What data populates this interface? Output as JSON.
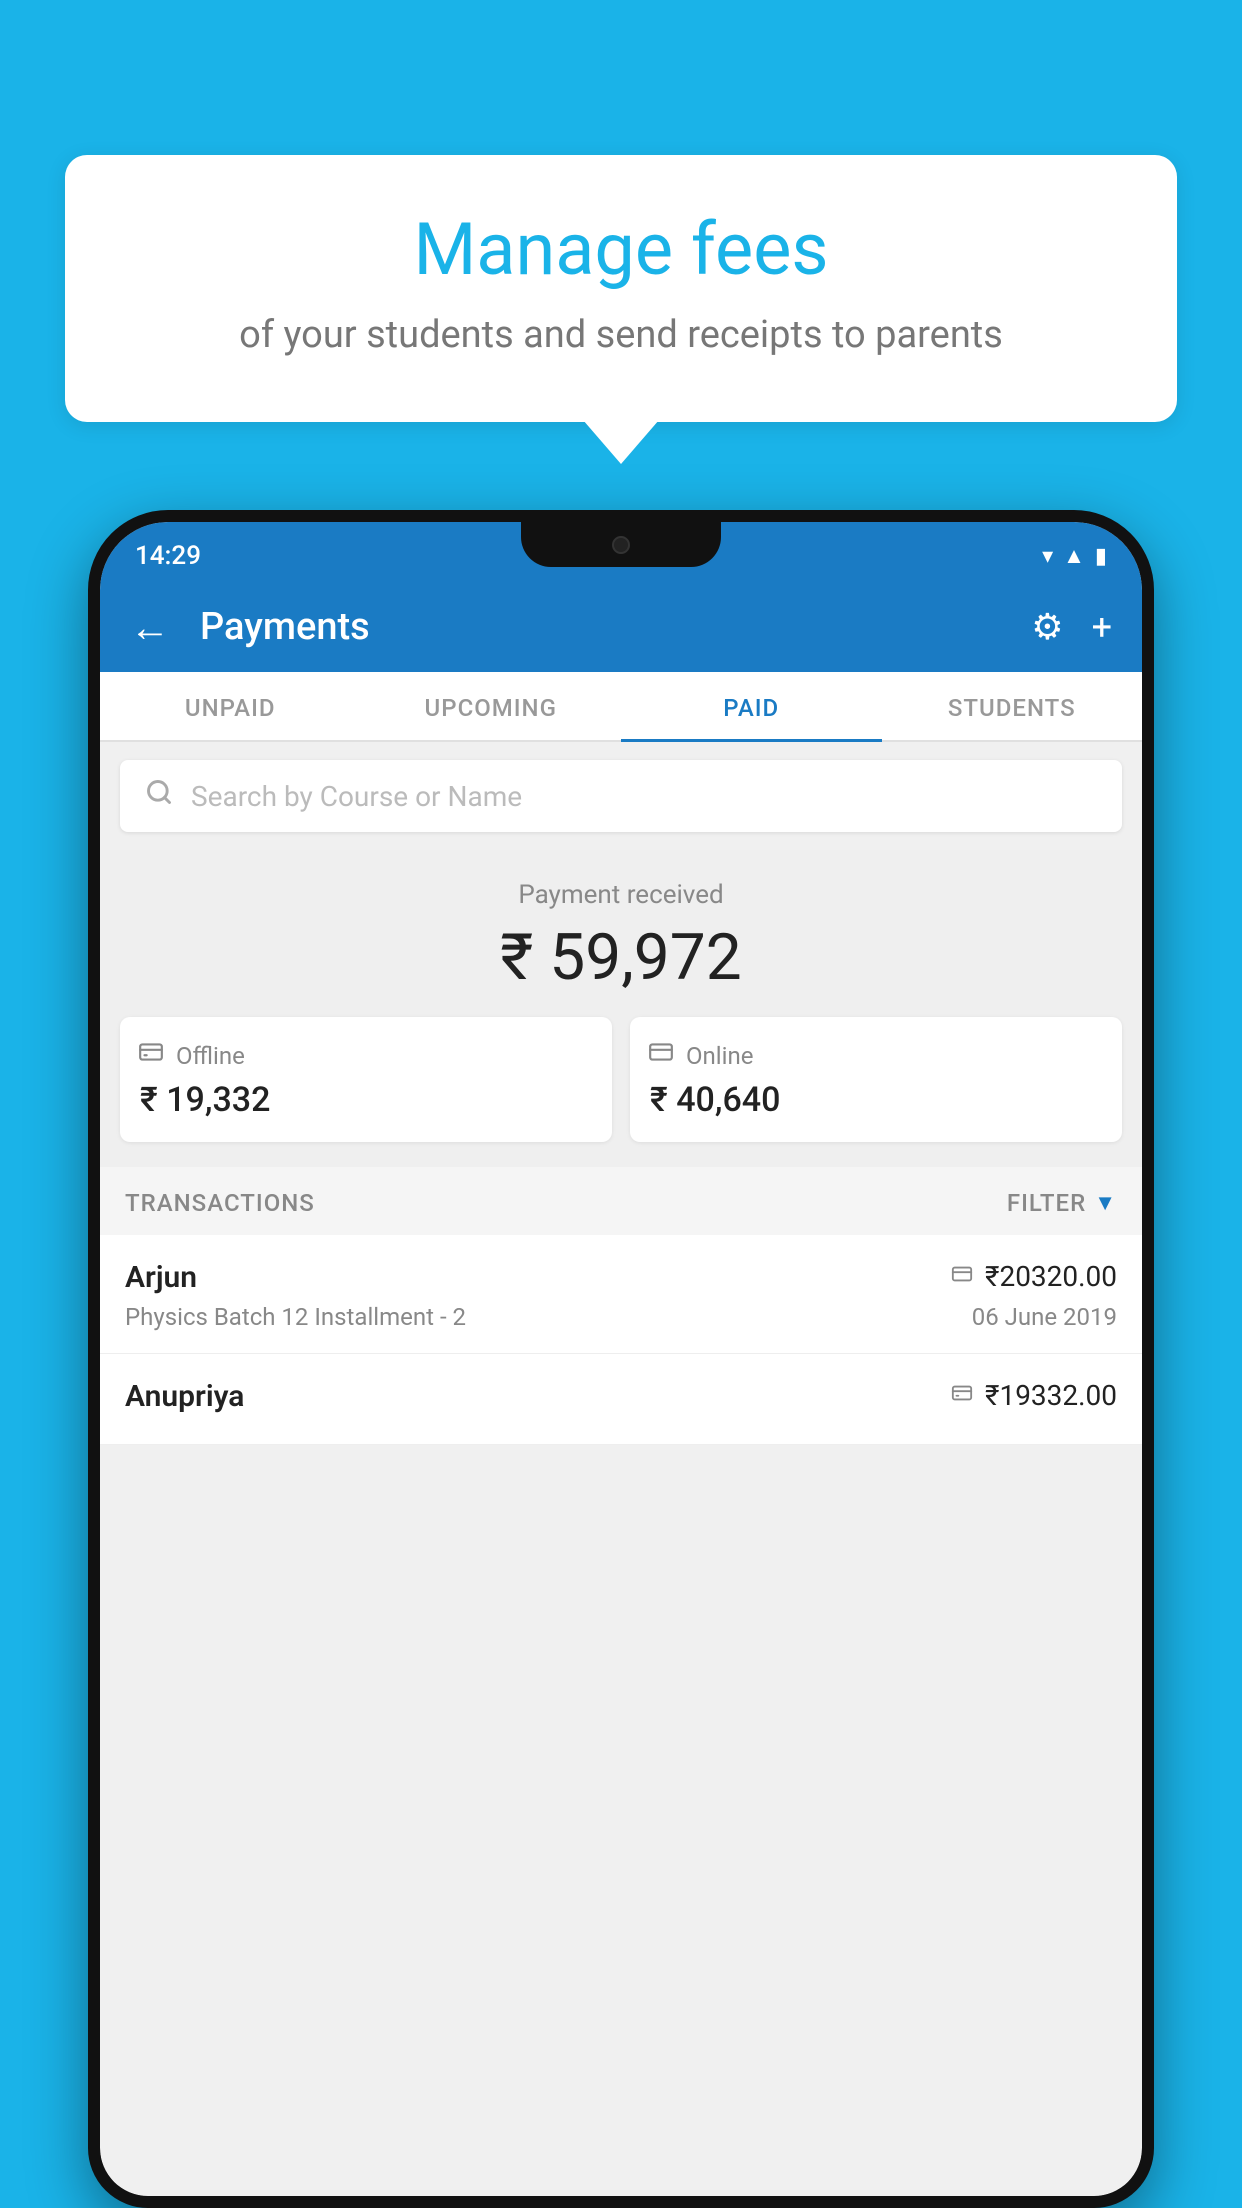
{
  "background_color": "#1ab3e8",
  "bubble": {
    "title": "Manage fees",
    "subtitle": "of your students and send receipts to parents"
  },
  "status_bar": {
    "time": "14:29",
    "wifi": "▾",
    "signal": "▲",
    "battery": "▮"
  },
  "header": {
    "title": "Payments",
    "back_label": "←",
    "gear_label": "⚙",
    "plus_label": "+"
  },
  "tabs": [
    {
      "label": "UNPAID",
      "active": false
    },
    {
      "label": "UPCOMING",
      "active": false
    },
    {
      "label": "PAID",
      "active": true
    },
    {
      "label": "STUDENTS",
      "active": false
    }
  ],
  "search": {
    "placeholder": "Search by Course or Name"
  },
  "payment_summary": {
    "label": "Payment received",
    "amount": "₹ 59,972",
    "offline": {
      "icon": "💳",
      "label": "Offline",
      "amount": "₹ 19,332"
    },
    "online": {
      "icon": "💳",
      "label": "Online",
      "amount": "₹ 40,640"
    }
  },
  "transactions": {
    "label": "TRANSACTIONS",
    "filter_label": "FILTER",
    "rows": [
      {
        "name": "Arjun",
        "amount": "₹20320.00",
        "course": "Physics Batch 12 Installment - 2",
        "date": "06 June 2019",
        "payment_type": "card"
      },
      {
        "name": "Anupriya",
        "amount": "₹19332.00",
        "course": "",
        "date": "",
        "payment_type": "cash"
      }
    ]
  }
}
